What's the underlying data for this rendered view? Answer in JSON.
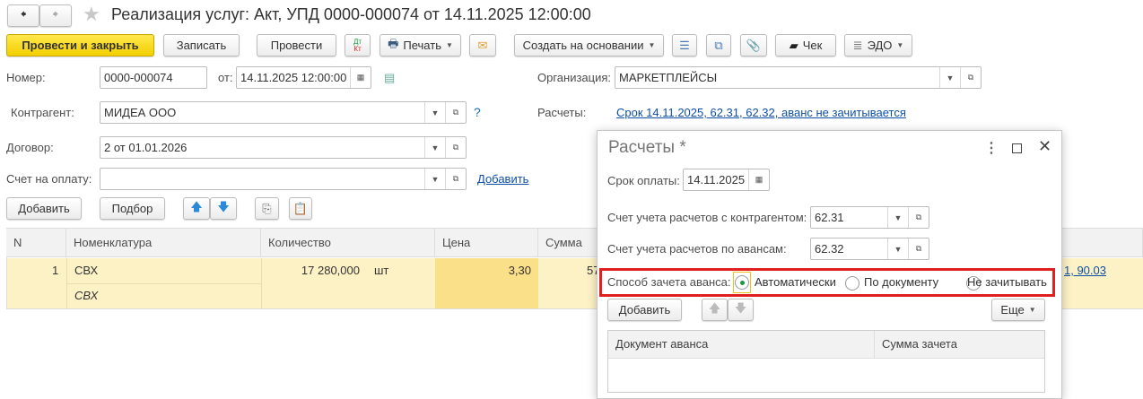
{
  "window": {
    "title": "Реализация услуг: Акт, УПД 0000-000074 от 14.11.2025 12:00:00"
  },
  "toolbar": {
    "post_close": "Провести и закрыть",
    "save": "Записать",
    "post": "Провести",
    "dtkt_dt": "Дт",
    "dtkt_kt": "Кт",
    "print": "Печать",
    "create_based": "Создать на основании",
    "check": "Чек",
    "edo": "ЭДО"
  },
  "form": {
    "number_label": "Номер:",
    "number": "0000-000074",
    "date_label": "от:",
    "date": "14.11.2025 12:00:00",
    "org_label": "Организация:",
    "org": "МАРКЕТПЛЕЙСЫ",
    "counterparty_label": "Контрагент:",
    "counterparty": "МИДЕА ООО",
    "help": "?",
    "settlements_label": "Расчеты:",
    "settlements_link": "Срок 14.11.2025, 62.31, 62.32, аванс не зачитывается",
    "contract_label": "Договор:",
    "contract": "2 от 01.01.2026",
    "invoice_label": "Счет на оплату:",
    "invoice": "",
    "invoice_add": "Добавить"
  },
  "table_toolbar": {
    "add": "Добавить",
    "pick": "Подбор"
  },
  "table": {
    "columns": [
      "N",
      "Номенклатура",
      "Количество",
      "Цена",
      "Сумма"
    ],
    "rows": [
      {
        "n": "1",
        "item": "СВХ",
        "item_desc": "СВХ",
        "qty": "17 280,000",
        "unit": "шт",
        "price": "3,30",
        "sum": "57",
        "accounts": "1, 90.03"
      }
    ]
  },
  "dialog": {
    "title": "Расчеты *",
    "due_label": "Срок оплаты:",
    "due": "14.11.2025",
    "acc_cp_label": "Счет учета расчетов с контрагентом:",
    "acc_cp": "62.31",
    "acc_adv_label": "Счет учета расчетов по авансам:",
    "acc_adv": "62.32",
    "offset_label": "Способ зачета аванса:",
    "options": [
      "Автоматически",
      "По документу",
      "Не зачитывать"
    ],
    "selected": 0,
    "add": "Добавить",
    "more": "Еще",
    "columns": [
      "Документ аванса",
      "Сумма зачета"
    ]
  },
  "colors": {
    "accent_yellow": "#f3cf00",
    "row_bg": "#fdf2c6",
    "highlight": "#e0201f",
    "link": "#0e4fa8"
  }
}
